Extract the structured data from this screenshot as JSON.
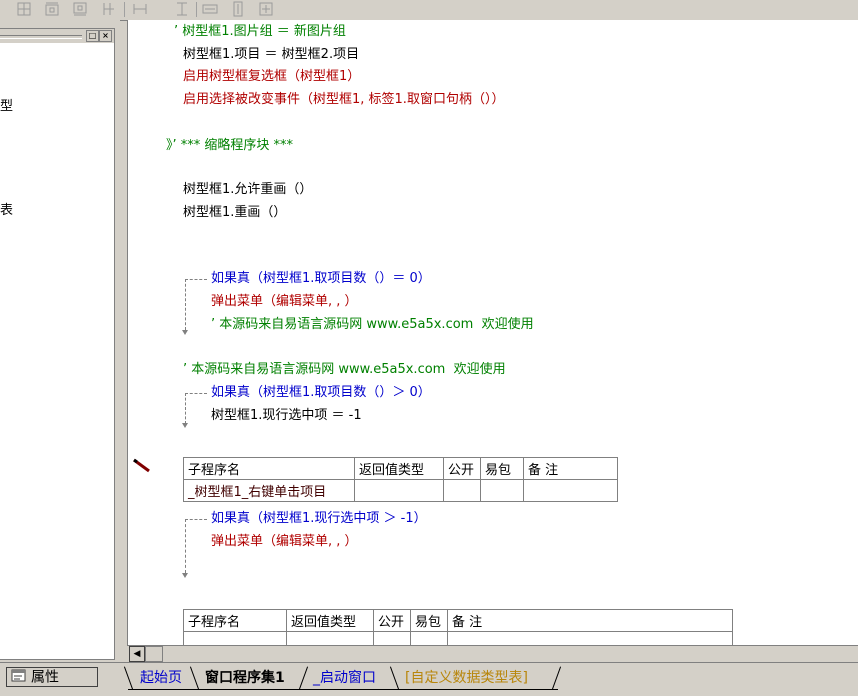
{
  "toolbar": {
    "icons": [
      "align-left-icon",
      "align-top-icon",
      "align-bottom-icon",
      "align-right-icon",
      "spacing-h-icon",
      "spacing-v-icon",
      "size-width-icon",
      "size-height-icon",
      "size-both-icon"
    ]
  },
  "left_panel": {
    "close_label": "×",
    "restore_label": "□",
    "fragments": [
      "型",
      "表"
    ]
  },
  "code": {
    "lines": [
      {
        "text": "’ 树型框1.图片组 ＝ 新图片组",
        "color": "green"
      },
      {
        "text": "树型框1.项目 ＝ 树型框2.项目",
        "color": "black"
      },
      {
        "text": "启用树型框复选框（树型框1）",
        "color": "red"
      },
      {
        "text": "启用选择被改变事件（树型框1, 标签1.取窗口句柄（））",
        "color": "red"
      },
      {
        "text": "》’ *** 缩略程序块 ***",
        "color": "green"
      },
      {
        "text": "树型框1.允许重画（）",
        "color": "black"
      },
      {
        "text": "树型框1.重画（）",
        "color": "black"
      },
      {
        "text": "如果真（树型框1.取项目数（）＝ 0）",
        "color": "blue"
      },
      {
        "text": "弹出菜单（编辑菜单, , ）",
        "color": "red"
      },
      {
        "text": "’ 本源码来自易语言源码网 www.e5a5x.com  欢迎使用",
        "color": "green"
      },
      {
        "text": "’ 本源码来自易语言源码网 www.e5a5x.com  欢迎使用",
        "color": "green"
      },
      {
        "text": "如果真（树型框1.取项目数（）＞ 0）",
        "color": "blue"
      },
      {
        "text": "树型框1.现行选中项 ＝ -1",
        "color": "black"
      },
      {
        "text": "如果真（树型框1.现行选中项 ＞ -1）",
        "color": "blue"
      },
      {
        "text": "弹出菜单（编辑菜单, , ）",
        "color": "red"
      }
    ],
    "table1": {
      "headers": [
        "子程序名",
        "返回值类型",
        "公开",
        "易包",
        "备 注"
      ],
      "row": [
        "_树型框1_右键单击项目",
        "",
        "",
        "",
        ""
      ]
    },
    "table2": {
      "headers": [
        "子程序名",
        "返回值类型",
        "公开",
        "易包",
        "备 注"
      ]
    }
  },
  "scroll": {
    "left_arrow": "◀"
  },
  "bottom": {
    "properties_button": "属性",
    "tabs": [
      "起始页",
      "窗口程序集1",
      "_启动窗口",
      "[自定义数据类型表]"
    ],
    "active_tab": "窗口程序集1"
  }
}
